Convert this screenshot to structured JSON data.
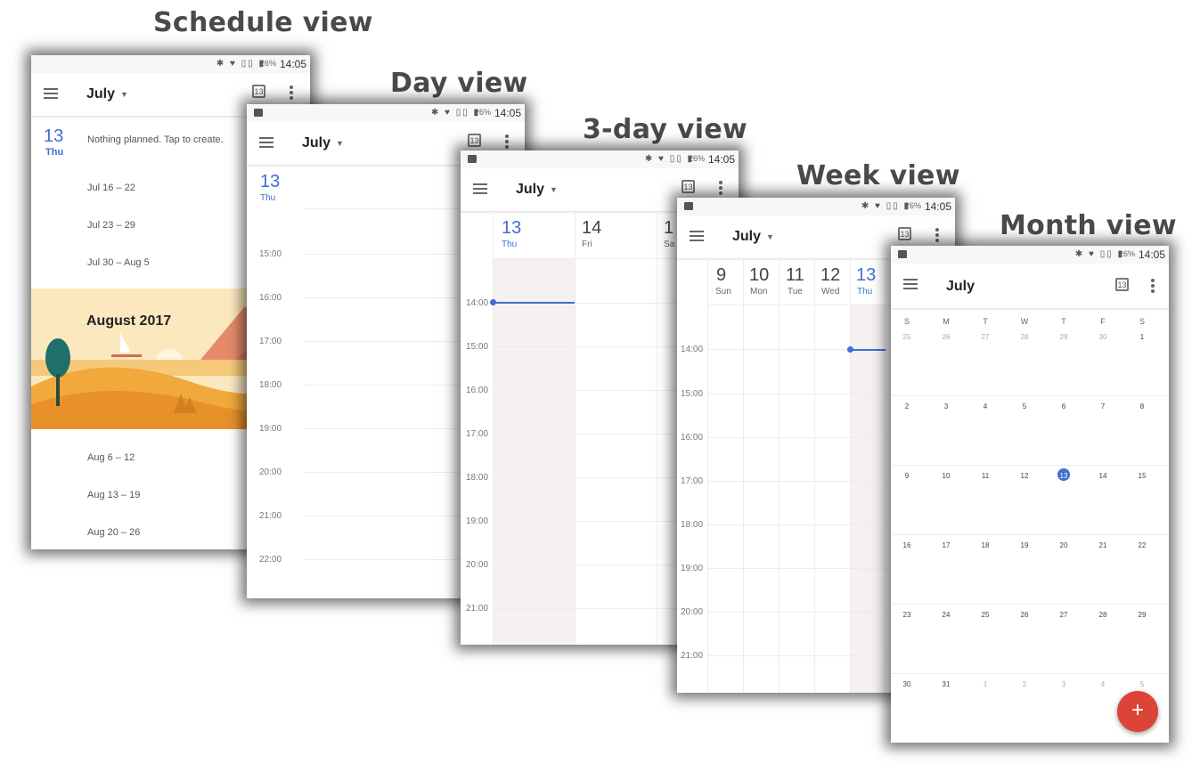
{
  "labels": {
    "schedule": "Schedule view",
    "day": "Day view",
    "three_day": "3-day view",
    "week": "Week view",
    "month": "Month view"
  },
  "status": {
    "battery": "26%",
    "time": "14:05"
  },
  "appbar": {
    "month": "July",
    "cal_icon_day": "13"
  },
  "schedule": {
    "today_num": "13",
    "today_name": "Thu",
    "nothing": "Nothing planned. Tap to create.",
    "weeks_before": [
      "Jul 16 – 22",
      "Jul 23 – 29",
      "Jul 30 – Aug 5"
    ],
    "banner": "August 2017",
    "weeks_after": [
      "Aug 6 – 12",
      "Aug 13 – 19",
      "Aug 20 – 26"
    ]
  },
  "day": {
    "num": "13",
    "name": "Thu",
    "hours": [
      "15:00",
      "16:00",
      "17:00",
      "18:00",
      "19:00",
      "20:00",
      "21:00",
      "22:00"
    ]
  },
  "three_day": {
    "days": [
      {
        "num": "13",
        "name": "Thu"
      },
      {
        "num": "14",
        "name": "Fri"
      },
      {
        "num": "1",
        "name": "Sa"
      }
    ],
    "hours": [
      "14:00",
      "15:00",
      "16:00",
      "17:00",
      "18:00",
      "19:00",
      "20:00",
      "21:00"
    ]
  },
  "week": {
    "days": [
      {
        "num": "9",
        "name": "Sun"
      },
      {
        "num": "10",
        "name": "Mon"
      },
      {
        "num": "11",
        "name": "Tue"
      },
      {
        "num": "12",
        "name": "Wed"
      },
      {
        "num": "13",
        "name": "Thu"
      }
    ],
    "hours": [
      "14:00",
      "15:00",
      "16:00",
      "17:00",
      "18:00",
      "19:00",
      "20:00",
      "21:00"
    ]
  },
  "month": {
    "headers": [
      "S",
      "M",
      "T",
      "W",
      "T",
      "F",
      "S"
    ],
    "rows": [
      [
        "25",
        "26",
        "27",
        "28",
        "29",
        "30",
        "1"
      ],
      [
        "2",
        "3",
        "4",
        "5",
        "6",
        "7",
        "8"
      ],
      [
        "9",
        "10",
        "11",
        "12",
        "13",
        "14",
        "15"
      ],
      [
        "16",
        "17",
        "18",
        "19",
        "20",
        "21",
        "22"
      ],
      [
        "23",
        "24",
        "25",
        "26",
        "27",
        "28",
        "29"
      ],
      [
        "30",
        "31",
        "1",
        "2",
        "3",
        "4",
        "5"
      ]
    ],
    "fab": "+"
  },
  "colors": {
    "accent": "#3f6fd1",
    "fab": "#db4437",
    "banner": "#f5c45a"
  }
}
